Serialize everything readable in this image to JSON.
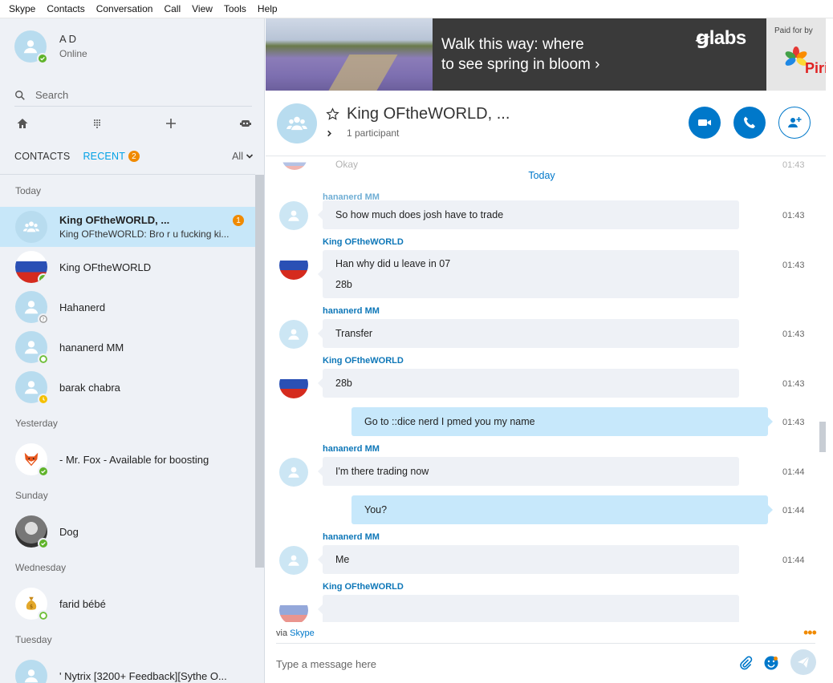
{
  "menu": [
    "Skype",
    "Contacts",
    "Conversation",
    "Call",
    "View",
    "Tools",
    "Help"
  ],
  "profile": {
    "name": "A D",
    "status": "Online"
  },
  "search": {
    "placeholder": "Search"
  },
  "tabs": {
    "contacts": "CONTACTS",
    "recent": "RECENT",
    "recent_badge": "2",
    "filter": "All"
  },
  "groups": {
    "today": "Today",
    "yesterday": "Yesterday",
    "sunday": "Sunday",
    "wednesday": "Wednesday",
    "tuesday": "Tuesday"
  },
  "recents": [
    {
      "name": "King OFtheWORLD, ...",
      "preview": "King OFtheWORLD: Bro r u fucking ki...",
      "unread": "1"
    },
    {
      "name": "King OFtheWORLD"
    },
    {
      "name": "Hahanerd"
    },
    {
      "name": "hananerd MM"
    },
    {
      "name": "barak chabra"
    },
    {
      "name": "- Mr. Fox - Available for boosting"
    },
    {
      "name": "Dog"
    },
    {
      "name": "farid bébé"
    },
    {
      "name": "'    Nytrix [3200+ Feedback][Sythe O..."
    }
  ],
  "ad": {
    "headline_1": "Walk this way: where",
    "headline_2": "to see spring in bloom  ›",
    "brand": "labs",
    "paid_for_by": "Paid for by",
    "sponsor": "Piri"
  },
  "conversation": {
    "title": "King OFtheWORLD, ...",
    "participants": "1 participant",
    "faded_message": "Okay",
    "faded_time": "01:43",
    "today_label": "Today"
  },
  "messages": [
    {
      "sender": "hananerd MM",
      "lines": [
        "So how much does josh have to trade"
      ],
      "time": "01:43"
    },
    {
      "sender": "King OFtheWORLD",
      "lines": [
        "Han why did u leave in 07",
        "28b"
      ],
      "time": "01:43"
    },
    {
      "sender": "hananerd MM",
      "lines": [
        "Transfer"
      ],
      "time": "01:43"
    },
    {
      "sender": "King OFtheWORLD",
      "lines": [
        "28b"
      ],
      "time": "01:43"
    },
    {
      "lines": [
        "Go to ::dice nerd I pmed you my name"
      ],
      "time": "01:43"
    },
    {
      "sender": "hananerd MM",
      "lines": [
        "I'm there trading now"
      ],
      "time": "01:44"
    },
    {
      "lines": [
        "You?"
      ],
      "time": "01:44"
    },
    {
      "sender": "hananerd MM",
      "lines": [
        "Me"
      ],
      "time": "01:44"
    },
    {
      "sender": "King OFtheWORLD"
    }
  ],
  "composer": {
    "via_prefix": "via",
    "via_link": "Skype",
    "placeholder": "Type a message here",
    "more": "•••"
  },
  "colors": {
    "accent": "#0078ca",
    "link": "#00a1e6",
    "badge": "#f08a00",
    "online": "#5fb32a",
    "selected_row": "#c7e7f9",
    "outgoing_bubble": "#c7e8fb",
    "incoming_bubble": "#eef1f6"
  }
}
